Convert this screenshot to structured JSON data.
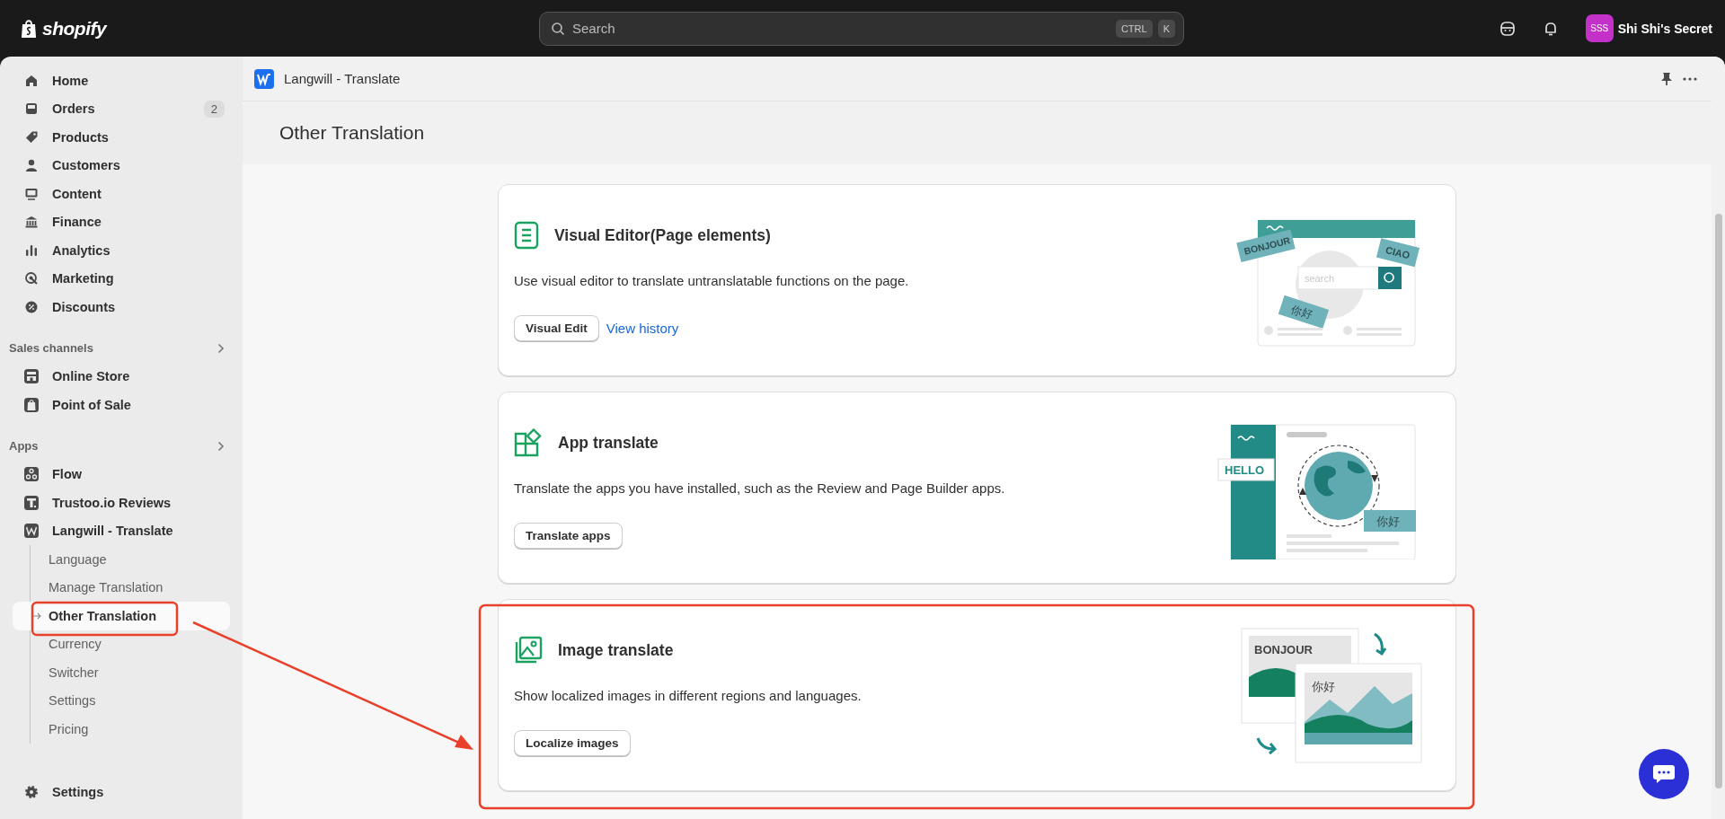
{
  "top_bar": {
    "logo": "shopify",
    "search": {
      "placeholder": "Search",
      "shortcut_keys": [
        "CTRL",
        "K"
      ]
    },
    "store": {
      "avatar": "SSS",
      "name": "Shi Shi's Secret"
    }
  },
  "sidebar": {
    "main_items": [
      {
        "label": "Home"
      },
      {
        "label": "Orders",
        "badge": "2"
      },
      {
        "label": "Products"
      },
      {
        "label": "Customers"
      },
      {
        "label": "Content"
      },
      {
        "label": "Finance"
      },
      {
        "label": "Analytics"
      },
      {
        "label": "Marketing"
      },
      {
        "label": "Discounts"
      }
    ],
    "sections": [
      {
        "title": "Sales channels",
        "items": [
          {
            "label": "Online Store"
          },
          {
            "label": "Point of Sale"
          }
        ]
      },
      {
        "title": "Apps",
        "items": [
          {
            "label": "Flow"
          },
          {
            "label": "Trustoo.io Reviews"
          },
          {
            "label": "Langwill - Translate",
            "children": [
              {
                "label": "Language",
                "selected": false
              },
              {
                "label": "Manage Translation",
                "selected": false
              },
              {
                "label": "Other Translation",
                "selected": true
              },
              {
                "label": "Currency",
                "selected": false
              },
              {
                "label": "Switcher",
                "selected": false
              },
              {
                "label": "Settings",
                "selected": false
              },
              {
                "label": "Pricing",
                "selected": false
              }
            ]
          }
        ]
      }
    ],
    "footer_item": "Settings"
  },
  "app_header": {
    "title": "Langwill - Translate"
  },
  "page": {
    "title": "Other Translation",
    "cards": [
      {
        "kind": "editor",
        "title": "Visual Editor(Page elements)",
        "description": "Use visual editor to translate untranslatable functions on the page.",
        "button": "Visual Edit",
        "link": "View history",
        "illustration_labels": [
          "BONJOUR",
          "CIAO",
          "search",
          "你好"
        ]
      },
      {
        "kind": "apps",
        "title": "App translate",
        "description": "Translate the apps you have installed, such as the Review and Page Builder apps.",
        "button": "Translate apps",
        "illustration_labels": [
          "HELLO",
          "你好"
        ]
      },
      {
        "kind": "image",
        "title": "Image translate",
        "description": "Show localized images in different regions and languages.",
        "button": "Localize images",
        "illustration_labels": [
          "BONJOUR",
          "你好"
        ]
      }
    ]
  }
}
